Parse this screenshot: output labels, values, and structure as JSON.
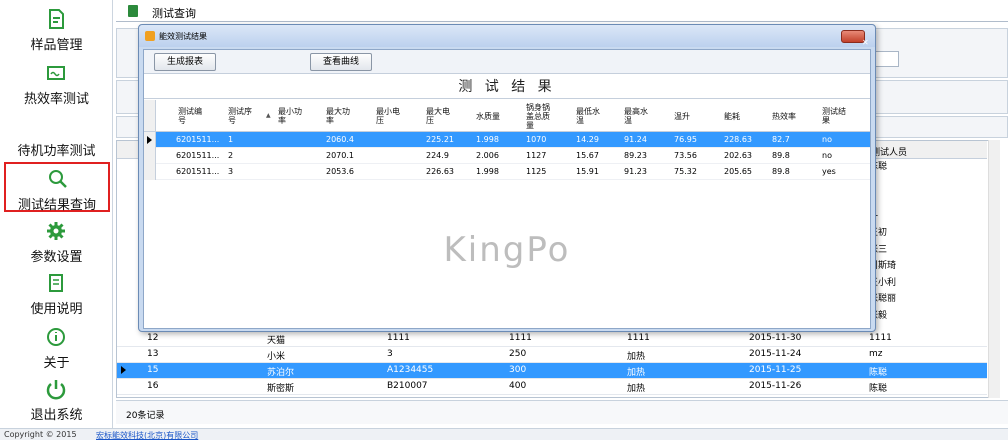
{
  "sidebar": {
    "items": [
      {
        "label": "样品管理",
        "icon": "document-icon"
      },
      {
        "label": "热效率测试",
        "icon": "monitor-icon"
      },
      {
        "label": "待机功率测试",
        "icon": "moon-icon"
      },
      {
        "label": "测试结果查询",
        "icon": "search-icon"
      },
      {
        "label": "参数设置",
        "icon": "gear-icon"
      },
      {
        "label": "使用说明",
        "icon": "manual-icon"
      },
      {
        "label": "关于",
        "icon": "info-icon"
      },
      {
        "label": "退出系统",
        "icon": "power-icon"
      }
    ]
  },
  "main": {
    "title": "测试查询",
    "grid_header_right": "测试人员",
    "right_column": [
      "陈聪",
      "一",
      "王初",
      "张三",
      "周斯琦",
      "王小利",
      "张聪丽",
      "张毅",
      "1111",
      "mz",
      "陈聪",
      "陈聪"
    ],
    "rows": [
      {
        "c1": "12",
        "c2": "天猫",
        "c3": "1111",
        "c4": "1111",
        "c5": "1111",
        "c6": "2015-11-30",
        "c7": "1111"
      },
      {
        "c1": "13",
        "c2": "小米",
        "c3": "3",
        "c4": "250",
        "c5": "加热",
        "c6": "2015-11-24",
        "c7": "mz"
      },
      {
        "c1": "15",
        "c2": "苏泊尔",
        "c3": "A1234455",
        "c4": "300",
        "c5": "加热",
        "c6": "2015-11-25",
        "c7": "陈聪"
      },
      {
        "c1": "16",
        "c2": "斯密斯",
        "c3": "B210007",
        "c4": "400",
        "c5": "加热",
        "c6": "2015-11-26",
        "c7": "陈聪"
      }
    ],
    "status": "20条记录"
  },
  "footer": {
    "copyright": "Copyright © 2015",
    "company": "宏标能效科技(北京)有限公司"
  },
  "dialog": {
    "title": "能效测试结果",
    "btn_report": "生成报表",
    "btn_curve": "查看曲线",
    "result_title": "测 试 结 果",
    "headers": [
      "测试编号",
      "测试序号",
      "最小功率",
      "最大功率",
      "最小电压",
      "最大电压",
      "水质量",
      "锅身锅盖总质量",
      "最低水温",
      "最高水温",
      "温升",
      "能耗",
      "热效率",
      "测试结果"
    ],
    "rows": [
      [
        "6201511...",
        "1",
        "",
        "2060.4",
        "",
        "225.21",
        "1.998",
        "1070",
        "14.29",
        "91.24",
        "76.95",
        "228.63",
        "82.7",
        "no"
      ],
      [
        "6201511...",
        "2",
        "",
        "2070.1",
        "",
        "224.9",
        "2.006",
        "1127",
        "15.67",
        "89.23",
        "73.56",
        "202.63",
        "89.8",
        "no"
      ],
      [
        "6201511...",
        "3",
        "",
        "2053.6",
        "",
        "226.63",
        "1.998",
        "1125",
        "15.91",
        "91.23",
        "75.32",
        "205.65",
        "89.8",
        "yes"
      ]
    ],
    "watermark": "KingPo"
  },
  "colors": {
    "selection": "#3399ff",
    "accent_red": "#e02020",
    "icon_green": "#2c8a3c"
  }
}
